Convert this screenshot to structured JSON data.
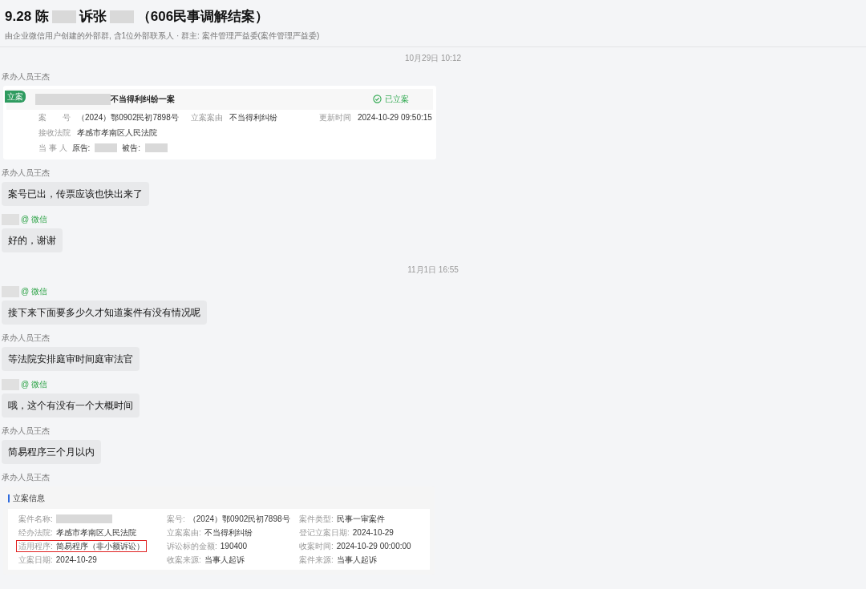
{
  "header": {
    "title_parts": [
      {
        "kind": "text",
        "text": "9.28 陈"
      },
      {
        "kind": "redacted"
      },
      {
        "kind": "text",
        "text": "诉张"
      },
      {
        "kind": "redacted"
      },
      {
        "kind": "text",
        "text": "（606民事调解结案）"
      }
    ],
    "subtitle": "由企业微信用户创建的外部群, 含1位外部联系人 · 群主: 案件管理严益委(案件管理严益委)"
  },
  "messages": [
    {
      "kind": "time",
      "text": "10月29日 10:12"
    },
    {
      "kind": "card_case",
      "sender": {
        "kind": "staff",
        "name": "承办人员王杰"
      },
      "tag": "立案",
      "title": "不当得利纠纷一案",
      "status": "已立案",
      "rows": [
        [
          {
            "label": "案　　号",
            "value": "（2024）鄂0902民初7898号"
          },
          {
            "label": "立案案由",
            "value": "不当得利纠纷"
          },
          {
            "label": "更新时间",
            "value": "2024-10-29 09:50:15"
          }
        ],
        [
          {
            "label": "接收法院",
            "value": "孝感市孝南区人民法院"
          }
        ]
      ],
      "party_label": "当 事 人",
      "plaintiff_label": "原告:",
      "defendant_label": "被告:"
    },
    {
      "kind": "text",
      "sender": {
        "kind": "staff",
        "name": "承办人员王杰"
      },
      "text": "案号已出，传票应该也快出来了"
    },
    {
      "kind": "text",
      "sender": {
        "kind": "wechat",
        "tag": "@ 微信"
      },
      "text": "好的，谢谢"
    },
    {
      "kind": "time",
      "text": "11月1日 16:55"
    },
    {
      "kind": "text",
      "sender": {
        "kind": "wechat",
        "tag": "@ 微信"
      },
      "text": "接下来下面要多少久才知道案件有没有情况呢"
    },
    {
      "kind": "text",
      "sender": {
        "kind": "staff",
        "name": "承办人员王杰"
      },
      "text": "等法院安排庭审时间庭审法官"
    },
    {
      "kind": "text",
      "sender": {
        "kind": "wechat",
        "tag": "@ 微信"
      },
      "text": "哦，这个有没有一个大概时间"
    },
    {
      "kind": "text",
      "sender": {
        "kind": "staff",
        "name": "承办人员王杰"
      },
      "text": "简易程序三个月以内"
    },
    {
      "kind": "card_info",
      "sender": {
        "kind": "staff",
        "name": "承办人员王杰"
      },
      "title": "立案信息",
      "fields": [
        {
          "label": "案件名称:",
          "redacted": true,
          "highlighted": false
        },
        {
          "label": "案号:",
          "value": "（2024）鄂0902民初7898号",
          "highlighted": false
        },
        {
          "label": "案件类型:",
          "value": "民事一审案件",
          "highlighted": false
        },
        {
          "label": "经办法院:",
          "value": "孝感市孝南区人民法院",
          "highlighted": false
        },
        {
          "label": "立案案由:",
          "value": "不当得利纠纷",
          "highlighted": false
        },
        {
          "label": "登记立案日期:",
          "value": "2024-10-29",
          "highlighted": false
        },
        {
          "label": "适用程序:",
          "value": "简易程序（非小额诉讼）",
          "highlighted": true
        },
        {
          "label": "诉讼标的金额:",
          "value": "190400",
          "highlighted": false
        },
        {
          "label": "收案时间:",
          "value": "2024-10-29 00:00:00",
          "highlighted": false
        },
        {
          "label": "立案日期:",
          "value": "2024-10-29",
          "highlighted": false
        },
        {
          "label": "收案来源:",
          "value": "当事人起诉",
          "highlighted": false
        },
        {
          "label": "案件来源:",
          "value": "当事人起诉",
          "highlighted": false
        }
      ]
    }
  ]
}
